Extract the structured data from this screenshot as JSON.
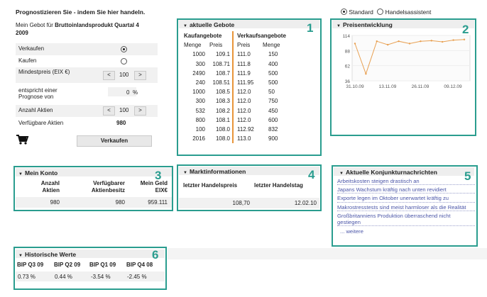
{
  "header": {
    "title": "Prognostizieren Sie - indem Sie hier handeln.",
    "mode_standard": "Standard",
    "mode_assistant": "Handelsassistent"
  },
  "order": {
    "bid_line1_prefix": "Mein Gebot für ",
    "bid_line1_bold": "Bruttoinlandsprodukt Quartal 4",
    "bid_line2": "2009",
    "sell_label": "Verkaufen",
    "buy_label": "Kaufen",
    "minprice_label": "Mindestpreis (EIX €)",
    "minprice_value": "100",
    "prognosis_label": "entspricht einer Prognose von",
    "prognosis_value": "0",
    "prognosis_unit": "%",
    "shares_label": "Anzahl Aktien",
    "shares_value": "100",
    "available_label": "Verfügbare Aktien",
    "available_value": "980",
    "submit_label": "Verkaufen",
    "dec": "<",
    "inc": ">"
  },
  "bids": {
    "title": "aktuelle Gebote",
    "buy_header": "Kaufangebote",
    "sell_header": "Verkaufsangebote",
    "col_qty": "Menge",
    "col_price": "Preis",
    "rows": [
      {
        "bq": "1000",
        "bp": "109.1",
        "sp": "111.0",
        "sq": "150"
      },
      {
        "bq": "300",
        "bp": "108.71",
        "sp": "111.8",
        "sq": "400"
      },
      {
        "bq": "2490",
        "bp": "108.7",
        "sp": "111.9",
        "sq": "500"
      },
      {
        "bq": "240",
        "bp": "108.51",
        "sp": "111.95",
        "sq": "500"
      },
      {
        "bq": "1000",
        "bp": "108.5",
        "sp": "112.0",
        "sq": "50"
      },
      {
        "bq": "300",
        "bp": "108.3",
        "sp": "112.0",
        "sq": "750"
      },
      {
        "bq": "532",
        "bp": "108.2",
        "sp": "112.0",
        "sq": "450"
      },
      {
        "bq": "800",
        "bp": "108.1",
        "sp": "112.0",
        "sq": "600"
      },
      {
        "bq": "100",
        "bp": "108.0",
        "sp": "112.92",
        "sq": "832"
      },
      {
        "bq": "2016",
        "bp": "108.0",
        "sp": "113.0",
        "sq": "900"
      }
    ]
  },
  "price_chart": {
    "title": "Preisentwicklung",
    "yticks": [
      "114",
      "88",
      "62",
      "36"
    ],
    "xticks": [
      "31.10.09",
      "13.11.09",
      "26.11.09",
      "09.12.09"
    ]
  },
  "chart_data": {
    "type": "line",
    "title": "Preisentwicklung",
    "ylim": [
      36,
      114
    ],
    "x": [
      "31.10.09",
      "03.11.09",
      "06.11.09",
      "09.11.09",
      "13.11.09",
      "17.11.09",
      "21.11.09",
      "26.11.09",
      "30.11.09",
      "04.12.09",
      "09.12.09"
    ],
    "series": [
      {
        "values": [
          100,
          48,
          104,
          98,
          104,
          100,
          104,
          105,
          103,
          106,
          107
        ]
      }
    ]
  },
  "account": {
    "title": "Mein Konto",
    "col1": "Anzahl Aktien",
    "col2": "Verfügbarer Aktienbesitz",
    "col3": "Mein Geld EIX€",
    "val1": "980",
    "val2": "980",
    "val3": "959.111"
  },
  "market": {
    "title": "Marktinformationen",
    "col1": "letzter Handelspreis",
    "col2": "letzter Handelstag",
    "val1": "108,70",
    "val2": "12.02.10"
  },
  "news": {
    "title": "Aktuelle Konjunkturnachrichten",
    "items": [
      "Arbeitskosten steigen drastisch an",
      "Japans Wachstum kräftig nach unten revidiert",
      "Exporte legen im Oktober unerwartet kräftig zu",
      "Makrostresstests sind meist harmloser als die Realität",
      "Großbritanniens Produktion überraschend nicht gestiegen"
    ],
    "more": "... weitere"
  },
  "history": {
    "title": "Historische Werte",
    "headers": [
      "BIP Q3 09",
      "BIP Q2 09",
      "BIP Q1 09",
      "BIP Q4 08"
    ],
    "values": [
      "0.73 %",
      "0.44 %",
      "-3.54 %",
      "-2.45 %"
    ]
  },
  "annotations": [
    "1",
    "2",
    "3",
    "4",
    "5",
    "6"
  ],
  "colors": {
    "highlight": "#2a9d8f",
    "chart_line": "#e8a052",
    "divider": "#e8953a",
    "link": "#4b56a8"
  }
}
